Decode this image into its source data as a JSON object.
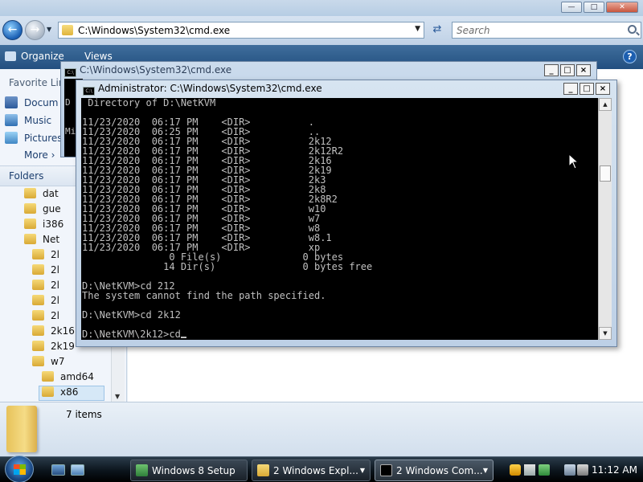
{
  "explorer": {
    "address": "C:\\Windows\\System32\\cmd.exe",
    "search_placeholder": "Search",
    "organize_label": "Organize",
    "views_label": "Views",
    "favorite_links_label": "Favorite Lin",
    "favorites": [
      {
        "label": "Docum",
        "icon": "documents-icon"
      },
      {
        "label": "Music",
        "icon": "music-icon"
      },
      {
        "label": "Pictures",
        "icon": "pictures-icon"
      },
      {
        "label": "More",
        "icon": "chevron-right-icon"
      }
    ],
    "folders_label": "Folders",
    "tree": [
      "dat",
      "gue",
      "i386",
      "Net",
      "2l",
      "2l",
      "2l",
      "2l",
      "2l",
      "2k16",
      "2k19",
      "w7",
      "amd64",
      "x86"
    ],
    "items_count": "7 items"
  },
  "cmd_back": {
    "title": "C:\\Windows\\System32\\cmd.exe",
    "visible_lines": [
      "D",
      "Mi",
      "",
      "Pr",
      "Ad",
      "Ad",
      "",
      "D:",
      "",
      "D:"
    ]
  },
  "cmd_front": {
    "title": "Administrator: C:\\Windows\\System32\\cmd.exe",
    "lines": [
      " Directory of D:\\NetKVM",
      "",
      "11/23/2020  06:17 PM    <DIR>          .",
      "11/23/2020  06:25 PM    <DIR>          ..",
      "11/23/2020  06:17 PM    <DIR>          2k12",
      "11/23/2020  06:17 PM    <DIR>          2k12R2",
      "11/23/2020  06:17 PM    <DIR>          2k16",
      "11/23/2020  06:17 PM    <DIR>          2k19",
      "11/23/2020  06:17 PM    <DIR>          2k3",
      "11/23/2020  06:17 PM    <DIR>          2k8",
      "11/23/2020  06:17 PM    <DIR>          2k8R2",
      "11/23/2020  06:17 PM    <DIR>          w10",
      "11/23/2020  06:17 PM    <DIR>          w7",
      "11/23/2020  06:17 PM    <DIR>          w8",
      "11/23/2020  06:17 PM    <DIR>          w8.1",
      "11/23/2020  06:17 PM    <DIR>          xp",
      "               0 File(s)              0 bytes",
      "              14 Dir(s)               0 bytes free",
      "",
      "D:\\NetKVM>cd 212",
      "The system cannot find the path specified.",
      "",
      "D:\\NetKVM>cd 2k12",
      "",
      "D:\\NetKVM\\2k12>cd"
    ]
  },
  "taskbar": {
    "tasks": [
      {
        "label": "Windows 8 Setup",
        "active": false
      },
      {
        "label": "2 Windows Expl...",
        "active": false
      },
      {
        "label": "2 Windows Com...",
        "active": true
      }
    ],
    "clock": "11:12 AM"
  }
}
